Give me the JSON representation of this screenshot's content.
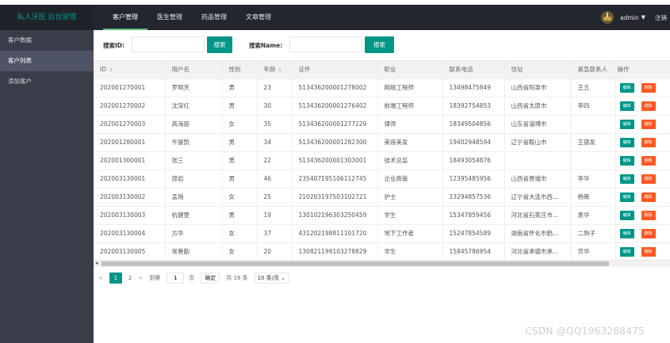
{
  "header": {
    "logo": "私人牙医 后台管理",
    "nav": [
      {
        "label": "客户管理",
        "active": true
      },
      {
        "label": "医生管理",
        "active": false
      },
      {
        "label": "药品管理",
        "active": false
      },
      {
        "label": "文章管理",
        "active": false
      }
    ],
    "user": "admin",
    "logout": "注销"
  },
  "sidebar": {
    "items": [
      {
        "label": "客户数据",
        "active": false
      },
      {
        "label": "客户列表",
        "active": true
      },
      {
        "label": "添加客户",
        "active": false
      }
    ]
  },
  "search": {
    "id_label": "搜索ID:",
    "id_value": "",
    "btn1": "搜索",
    "name_label": "搜索Name:",
    "name_value": "",
    "btn2": "搜索"
  },
  "table": {
    "columns": [
      "ID",
      "用户名",
      "性别",
      "年龄",
      "证件",
      "职业",
      "联系电话",
      "住址",
      "紧急联系人",
      "操作"
    ],
    "edit_label": "编辑",
    "delete_label": "删除",
    "rows": [
      [
        "202001270001",
        "罗明天",
        "男",
        "23",
        "513436200001278002",
        "网络工程师",
        "13498475849",
        "山西省阳泉市",
        "王五"
      ],
      [
        "202001270002",
        "沈深红",
        "男",
        "30",
        "513436200001276402",
        "前端工程师",
        "18392754853",
        "山西省太原市",
        "李四"
      ],
      [
        "202001270003",
        "高海丽",
        "女",
        "35",
        "513436200001277229",
        "律师",
        "18349504856",
        "山东省淄博市",
        ""
      ],
      [
        "202001280001",
        "牛骏凯",
        "男",
        "34",
        "513436200001282300",
        "美容美发",
        "19402948594",
        "辽宁省鞍山市",
        "王德发"
      ],
      [
        "202001300001",
        "张三",
        "男",
        "22",
        "513436200001303001",
        "技术总监",
        "18493054876",
        "",
        ""
      ],
      [
        "202003130001",
        "邵岩",
        "男",
        "46",
        "235407195106112745",
        "企业高管",
        "12395485956",
        "山西省晋城市",
        "李华"
      ],
      [
        "202003130002",
        "孟琬",
        "女",
        "25",
        "210203197503102721",
        "护士",
        "13294857536",
        "辽宁省大连市西...",
        "杨策"
      ],
      [
        "202003130003",
        "杭健雯",
        "男",
        "19",
        "130102196303250459",
        "学生",
        "15347859456",
        "河北省石家庄市...",
        "袁华"
      ],
      [
        "202003130004",
        "方华",
        "女",
        "37",
        "431202198811101720",
        "地下工作者",
        "15247854589",
        "湖南省怀化市鹤...",
        "二狗子"
      ],
      [
        "202003130005",
        "常善勤",
        "女",
        "20",
        "130821199103278829",
        "学生",
        "15845786954",
        "河北省承德市承...",
        "芳华"
      ]
    ]
  },
  "pager": {
    "prev": "<",
    "pages": [
      "1",
      "2"
    ],
    "current": "1",
    "next": ">",
    "goto": "到第",
    "goto_value": "1",
    "page_unit": "页",
    "confirm": "确定",
    "total": "共 19 条",
    "size": "10 条/页"
  },
  "colors": {
    "header_bg": "#23262e",
    "sidebar_bg": "#393d49",
    "primary": "#009688",
    "danger": "#ff5722"
  },
  "watermark": "CSDN @QQ1963288475"
}
